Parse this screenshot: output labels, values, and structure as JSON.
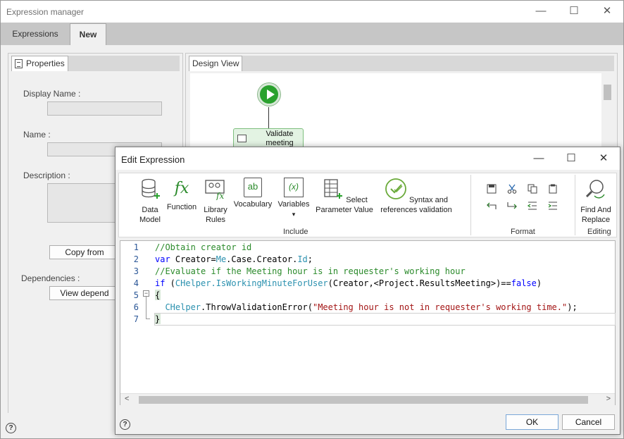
{
  "main_window": {
    "title": "Expression manager",
    "controls": {
      "minimize": "—",
      "maximize": "☐",
      "close": "✕"
    },
    "tabs": [
      {
        "label": "Expressions"
      },
      {
        "label": "New"
      }
    ]
  },
  "properties": {
    "tab_label": "Properties",
    "display_name_label": "Display Name :",
    "name_label": "Name :",
    "description_label": "Description :",
    "copy_button": "Copy from",
    "dependencies_label": "Dependencies :",
    "view_dependencies_button": "View depend"
  },
  "design_view": {
    "tab_label": "Design View",
    "task_node_label": "Validate meeting"
  },
  "help": {
    "symbol": "?"
  },
  "dialog": {
    "title": "Edit Expression",
    "controls": {
      "minimize": "—",
      "maximize": "☐",
      "close": "✕"
    },
    "ribbon": {
      "include_group": "Include",
      "format_group": "Format",
      "editing_group": "Editing",
      "buttons": {
        "data_model": "Data Model",
        "function": "Function",
        "library_rules": "Library Rules",
        "vocabulary": "Vocabulary",
        "variables": "Variables",
        "select_parameter_value": "Select Parameter Value",
        "syntax_validation": "Syntax and references validation",
        "find_replace": "Find And Replace"
      },
      "icons": {
        "function_glyph": "fx",
        "vocabulary_glyph": "ab",
        "variables_glyph": "(x)",
        "dropdown_glyph": "▾"
      }
    },
    "editor": {
      "line_numbers": [
        "1",
        "2",
        "3",
        "4",
        "5",
        "6",
        "7"
      ],
      "lines": {
        "l1": "//Obtain creator id",
        "l2_kw": "var",
        "l2_a": " Creator=",
        "l2_me": "Me",
        "l2_b": ".Case.Creator.",
        "l2_id": "Id",
        "l2_c": ";",
        "l3": "//Evaluate if the Meeting hour is in requester's working hour",
        "l4_kw": "if",
        "l4_a": " (",
        "l4_ty": "CHelper",
        "l4_m": ".IsWorkingMinuteForUser",
        "l4_b": "(Creator,<Project.ResultsMeeting>)==",
        "l4_false": "false",
        "l4_c": ")",
        "l5": "{",
        "l6_indent": "  ",
        "l6_ty": "CHelper",
        "l6_a": ".ThrowValidationError(",
        "l6_str": "\"Meeting hour is not in requester's working time.\"",
        "l6_b": ");",
        "l7": "}"
      },
      "fold_symbol": "−",
      "scroll_left": "<",
      "scroll_right": ">"
    },
    "ok_button": "OK",
    "cancel_button": "Cancel"
  },
  "colors": {
    "accent_green": "#2aa12e",
    "comment_green": "#2a8a2a",
    "keyword_blue": "#0000ff",
    "type_teal": "#2b91af",
    "string_red": "#a31515"
  }
}
